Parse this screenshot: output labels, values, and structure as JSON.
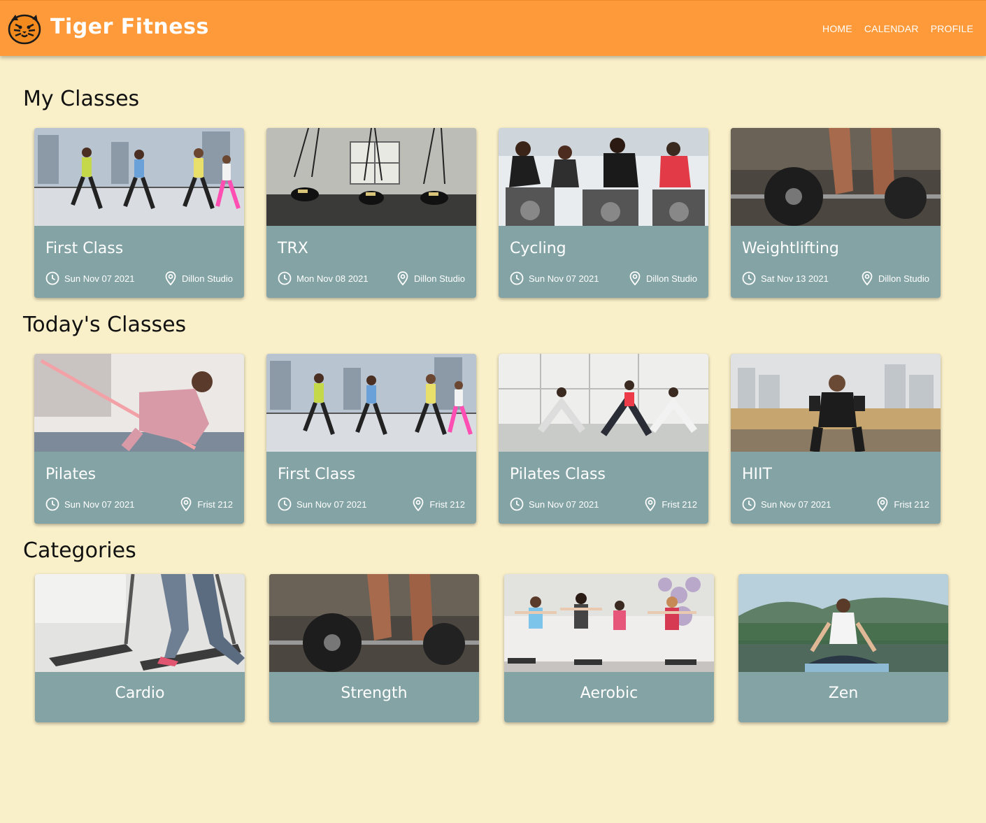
{
  "app": {
    "brand": "Tiger Fitness",
    "logo_icon": "tiger-icon"
  },
  "nav": {
    "home": "HOME",
    "calendar": "CALENDAR",
    "profile": "PROFILE"
  },
  "colors": {
    "header": "#fe9a3a",
    "background": "#f9efc9",
    "card": "#83a3a5"
  },
  "sections": {
    "my_classes": "My Classes",
    "todays_classes": "Today's Classes",
    "categories": "Categories"
  },
  "my_classes": [
    {
      "title": "First Class",
      "date": "Sun Nov 07 2021",
      "location": "Dillon Studio",
      "image": "dance-class-photo"
    },
    {
      "title": "TRX",
      "date": "Mon Nov 08 2021",
      "location": "Dillon Studio",
      "image": "trx-photo"
    },
    {
      "title": "Cycling",
      "date": "Sun Nov 07 2021",
      "location": "Dillon Studio",
      "image": "cycling-photo"
    },
    {
      "title": "Weightlifting",
      "date": "Sat Nov 13 2021",
      "location": "Dillon Studio",
      "image": "barbell-photo"
    }
  ],
  "todays_classes": [
    {
      "title": "Pilates",
      "date": "Sun Nov 07 2021",
      "location": "Frist 212",
      "image": "pilates-band-photo"
    },
    {
      "title": "First Class",
      "date": "Sun Nov 07 2021",
      "location": "Frist 212",
      "image": "dance-class-photo"
    },
    {
      "title": "Pilates Class",
      "date": "Sun Nov 07 2021",
      "location": "Frist 212",
      "image": "yoga-class-photo"
    },
    {
      "title": "HIIT",
      "date": "Sun Nov 07 2021",
      "location": "Frist 212",
      "image": "dumbbell-rooftop-photo"
    }
  ],
  "categories": [
    {
      "label": "Cardio",
      "image": "treadmill-photo"
    },
    {
      "label": "Strength",
      "image": "barbell-photo"
    },
    {
      "label": "Aerobic",
      "image": "aerobic-class-photo"
    },
    {
      "label": "Zen",
      "image": "meditation-photo"
    }
  ]
}
